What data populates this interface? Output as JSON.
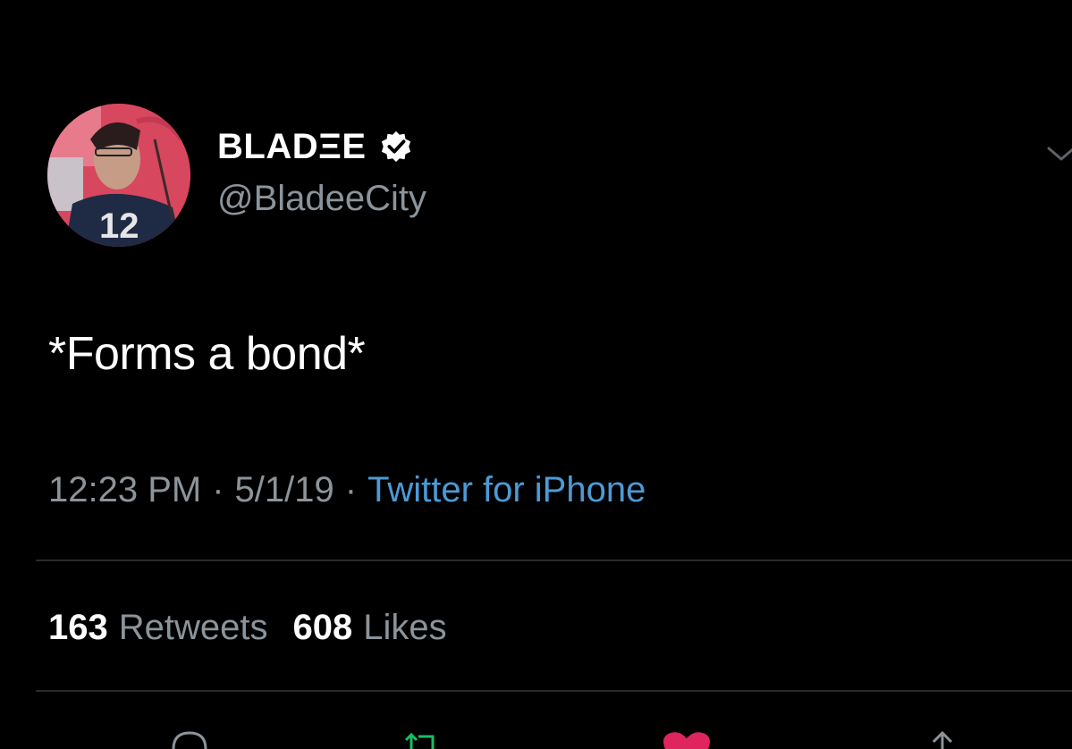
{
  "author": {
    "display_name": "BLADΞE",
    "handle": "@BladeeCity",
    "verified": true,
    "avatar_icon": "avatar-photo"
  },
  "tweet": {
    "text": "*Forms a bond*",
    "time": "12:23 PM",
    "date": "5/1/19",
    "separator": "·",
    "source": "Twitter for iPhone"
  },
  "stats": {
    "retweets_count": "163",
    "retweets_label": "Retweets",
    "likes_count": "608",
    "likes_label": "Likes"
  },
  "actions": [
    {
      "icon": "reply-icon"
    },
    {
      "icon": "retweet-icon"
    },
    {
      "icon": "like-icon"
    },
    {
      "icon": "share-icon"
    }
  ],
  "colors": {
    "background": "#000000",
    "secondary_text": "#8b949a",
    "link": "#4b9bd6",
    "like": "#e0245e",
    "retweet": "#17bf63"
  }
}
